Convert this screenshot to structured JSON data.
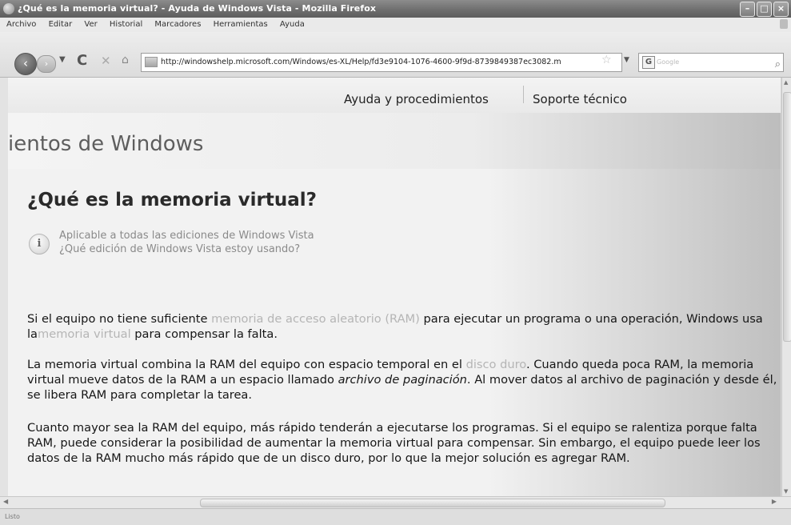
{
  "window": {
    "title": "¿Qué es la memoria virtual? - Ayuda de Windows Vista - Mozilla Firefox",
    "controls": {
      "minimize": "–",
      "maximize": "□",
      "close": "×"
    }
  },
  "menu": [
    "Archivo",
    "Editar",
    "Ver",
    "Historial",
    "Marcadores",
    "Herramientas",
    "Ayuda"
  ],
  "nav": {
    "back_icon": "back-arrow-icon",
    "url": "http://windowshelp.microsoft.com/Windows/es-XL/Help/fd3e9104-1076-4600-9f9d-8739849387ec3082.m",
    "search_placeholder": "Google",
    "search_engine_label": "G"
  },
  "site_nav": {
    "link1": "Ayuda y procedimientos",
    "link2": "Soporte técnico"
  },
  "header": {
    "brand_fragment": "ientos de Windows"
  },
  "article": {
    "title": "¿Qué es la memoria virtual?",
    "applies_line1": "Aplicable a todas las ediciones de Windows Vista",
    "applies_line2": "¿Qué edición de Windows Vista estoy usando?",
    "p1": {
      "a": "Si el equipo no tiene suficiente ",
      "link1": "memoria de acceso aleatorio (RAM)",
      "b": " para ejecutar un programa o una operación, Windows usa la",
      "link2": "memoria virtual",
      "c": " para compensar la falta."
    },
    "p2": {
      "a": "La memoria virtual combina la RAM del equipo con espacio temporal en el ",
      "link": "disco duro",
      "b": ". Cuando queda poca RAM, la memoria virtual mueve datos de la RAM a un espacio llamado ",
      "em": "archivo de paginación",
      "c": ". Al mover datos al archivo de paginación y desde él, se libera RAM para completar la tarea."
    },
    "p3": "Cuanto mayor sea la RAM del equipo, más rápido tenderán a ejecutarse los programas. Si el equipo se ralentiza porque falta RAM, puede considerar la posibilidad de aumentar la memoria virtual para compensar. Sin embargo, el equipo puede leer los datos de la RAM mucho más rápido que de un disco duro, por lo que la mejor solución es agregar RAM."
  },
  "status": "Listo"
}
